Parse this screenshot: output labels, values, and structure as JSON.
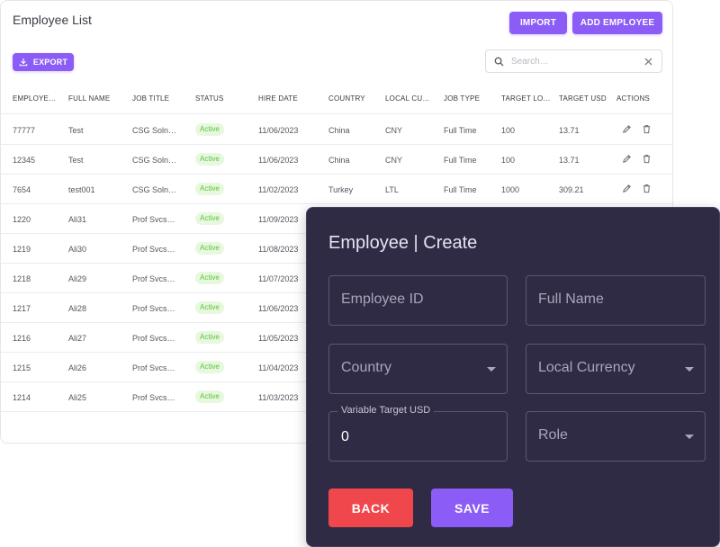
{
  "list": {
    "title": "Employee List",
    "import_label": "IMPORT",
    "add_label": "ADD EMPLOYEE",
    "export_label": "EXPORT",
    "search_placeholder": "Search…",
    "columns": [
      "EMPLOYE…",
      "FULL NAME",
      "JOB TITLE",
      "STATUS",
      "HIRE DATE",
      "COUNTRY",
      "LOCAL CU…",
      "JOB TYPE",
      "TARGET LO…",
      "TARGET USD",
      "ACTIONS"
    ],
    "rows": [
      {
        "id": "77777",
        "name": "Test",
        "title": "CSG Soln…",
        "status": "Active",
        "hire": "11/06/2023",
        "country": "China",
        "currency": "CNY",
        "type": "Full Time",
        "target_local": "100",
        "target_usd": "13.71"
      },
      {
        "id": "12345",
        "name": "Test",
        "title": "CSG Soln…",
        "status": "Active",
        "hire": "11/06/2023",
        "country": "China",
        "currency": "CNY",
        "type": "Full Time",
        "target_local": "100",
        "target_usd": "13.71"
      },
      {
        "id": "7654",
        "name": "test001",
        "title": "CSG Soln…",
        "status": "Active",
        "hire": "11/02/2023",
        "country": "Turkey",
        "currency": "LTL",
        "type": "Full Time",
        "target_local": "1000",
        "target_usd": "309.21"
      },
      {
        "id": "1220",
        "name": "Ali31",
        "title": "Prof Svcs…",
        "status": "Active",
        "hire": "11/09/2023"
      },
      {
        "id": "1219",
        "name": "Ali30",
        "title": "Prof Svcs…",
        "status": "Active",
        "hire": "11/08/2023"
      },
      {
        "id": "1218",
        "name": "Ali29",
        "title": "Prof Svcs…",
        "status": "Active",
        "hire": "11/07/2023"
      },
      {
        "id": "1217",
        "name": "Ali28",
        "title": "Prof Svcs…",
        "status": "Active",
        "hire": "11/06/2023"
      },
      {
        "id": "1216",
        "name": "Ali27",
        "title": "Prof Svcs…",
        "status": "Active",
        "hire": "11/05/2023"
      },
      {
        "id": "1215",
        "name": "Ali26",
        "title": "Prof Svcs…",
        "status": "Active",
        "hire": "11/04/2023"
      },
      {
        "id": "1214",
        "name": "Ali25",
        "title": "Prof Svcs…",
        "status": "Active",
        "hire": "11/03/2023"
      }
    ]
  },
  "dialog": {
    "title": "Employee | Create",
    "employee_id_placeholder": "Employee ID",
    "full_name_placeholder": "Full Name",
    "country_placeholder": "Country",
    "currency_placeholder": "Local Currency",
    "target_label": "Variable Target USD",
    "target_value": "0",
    "role_placeholder": "Role",
    "back_label": "BACK",
    "save_label": "SAVE"
  },
  "icons": {
    "export": "download-icon",
    "search": "search-icon",
    "clear": "close-icon",
    "edit": "pencil-icon",
    "delete": "trash-icon",
    "dropdown": "caret-down-icon"
  },
  "colors": {
    "accent": "#8b5cf6",
    "danger": "#f0474d",
    "dialog_bg": "#302b45",
    "status_active": "#5cc33a"
  }
}
